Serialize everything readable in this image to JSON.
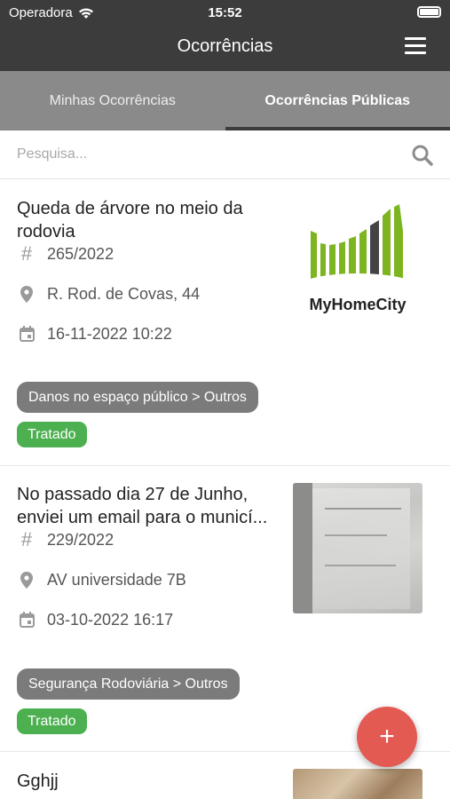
{
  "status_bar": {
    "carrier": "Operadora",
    "time": "15:52"
  },
  "header": {
    "title": "Ocorrências"
  },
  "tabs": [
    {
      "label": "Minhas Ocorrências",
      "active": false
    },
    {
      "label": "Ocorrências Públicas",
      "active": true
    }
  ],
  "search": {
    "placeholder": "Pesquisa..."
  },
  "occurrences": [
    {
      "title": "Queda de árvore no meio da rodovia",
      "number": "265/2022",
      "address": "R. Rod. de Covas, 44",
      "datetime": "16-11-2022 10:22",
      "category": "Danos no espaço público > Outros",
      "status": "Tratado",
      "thumbnail_logo_text": "MyHomeCity"
    },
    {
      "title": "No passado dia 27 de Junho, enviei um email para o municí...",
      "number": "229/2022",
      "address": "AV universidade 7B",
      "datetime": "03-10-2022 16:17",
      "category": "Segurança Rodoviária > Outros",
      "status": "Tratado"
    },
    {
      "title": "Gghjj"
    }
  ],
  "fab": {
    "label": "+"
  },
  "colors": {
    "header": "#3c3c3c",
    "tab_bar": "#8a8a8a",
    "status_green": "#4cb050",
    "chip_gray": "#7b7b7b",
    "fab_red": "#e35a52",
    "logo_green": "#7cb51f"
  }
}
